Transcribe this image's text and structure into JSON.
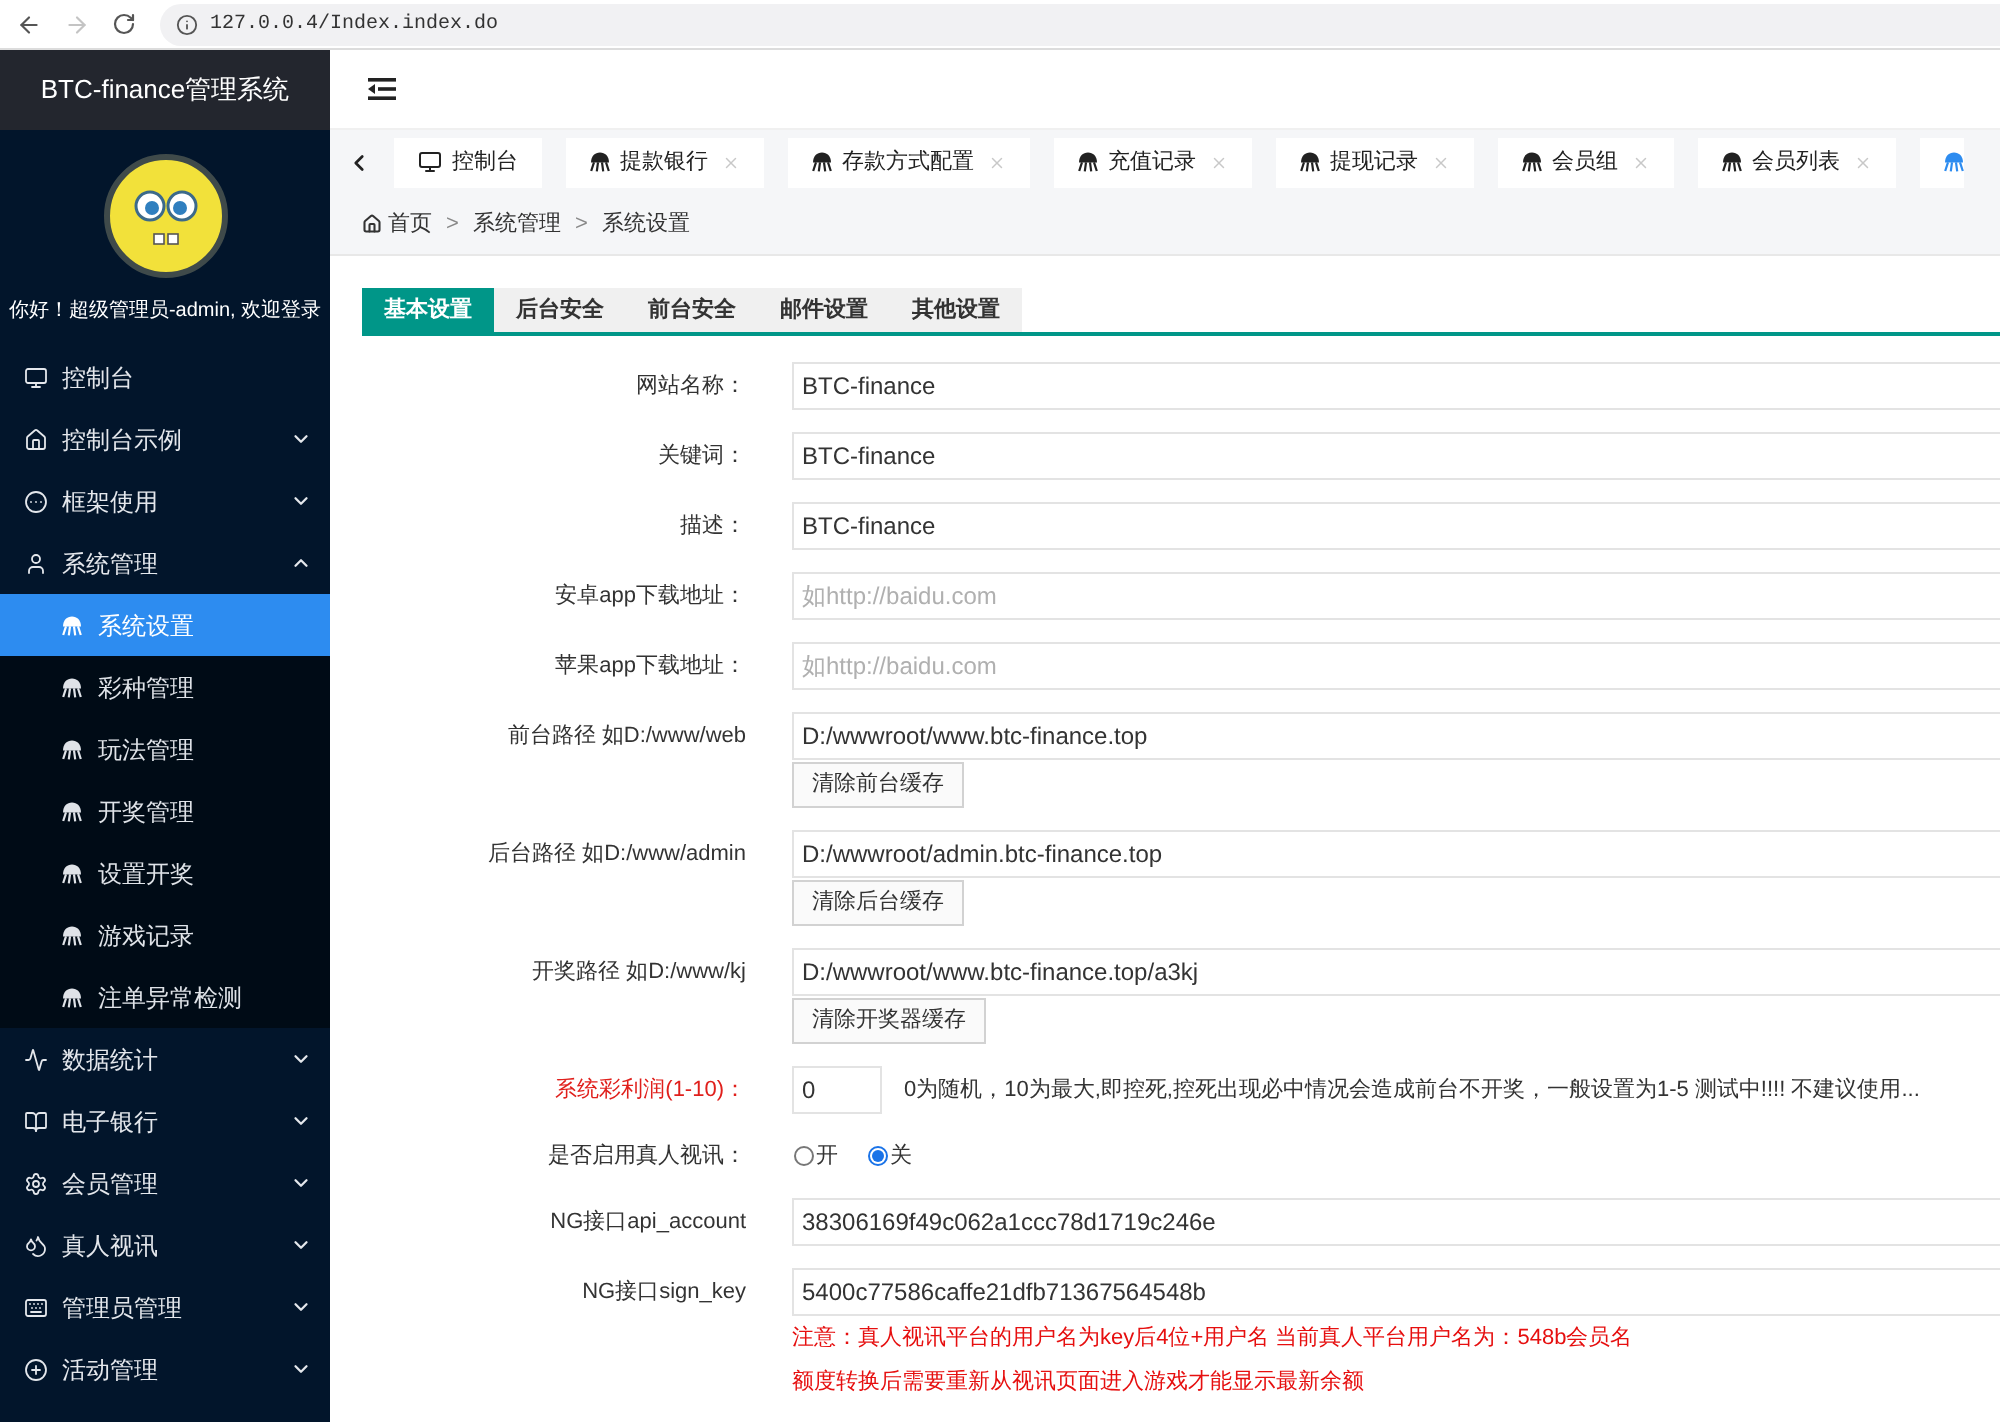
{
  "browser": {
    "back": {
      "disabled": false
    },
    "forward": {
      "disabled": true
    },
    "url": "127.0.0.4/Index.index.do"
  },
  "sidebar": {
    "title": "BTC-finance管理系统",
    "greeting": "你好！超级管理员-admin, 欢迎登录",
    "items": [
      {
        "kind": "link",
        "label": "控制台"
      },
      {
        "kind": "group",
        "label": "控制台示例",
        "expanded": false
      },
      {
        "kind": "group",
        "label": "框架使用",
        "expanded": false
      },
      {
        "kind": "group",
        "label": "系统管理",
        "expanded": true,
        "children": [
          {
            "label": "系统设置",
            "selected": true
          },
          {
            "label": "彩种管理",
            "selected": false
          },
          {
            "label": "玩法管理",
            "selected": false
          },
          {
            "label": "开奖管理",
            "selected": false
          },
          {
            "label": "设置开奖",
            "selected": false
          },
          {
            "label": "游戏记录",
            "selected": false
          },
          {
            "label": "注单异常检测",
            "selected": false
          }
        ]
      },
      {
        "kind": "group",
        "label": "数据统计",
        "expanded": false
      },
      {
        "kind": "group",
        "label": "电子银行",
        "expanded": false
      },
      {
        "kind": "group",
        "label": "会员管理",
        "expanded": false
      },
      {
        "kind": "group",
        "label": "真人视讯",
        "expanded": false
      },
      {
        "kind": "group",
        "label": "管理员管理",
        "expanded": false
      },
      {
        "kind": "group",
        "label": "活动管理",
        "expanded": false
      }
    ]
  },
  "page_tabs": [
    {
      "kind": "dashboard",
      "label": "控制台",
      "closable": false,
      "selected": false
    },
    {
      "kind": "page",
      "label": "提款银行",
      "closable": true,
      "selected": false
    },
    {
      "kind": "page",
      "label": "存款方式配置",
      "closable": true,
      "selected": false
    },
    {
      "kind": "page",
      "label": "充值记录",
      "closable": true,
      "selected": false
    },
    {
      "kind": "page",
      "label": "提现记录",
      "closable": true,
      "selected": false
    },
    {
      "kind": "page",
      "label": "会员组",
      "closable": true,
      "selected": false
    },
    {
      "kind": "page",
      "label": "会员列表",
      "closable": true,
      "selected": false
    },
    {
      "kind": "page",
      "closable": false,
      "selected": true
    }
  ],
  "breadcrumb": {
    "separator": ">",
    "items": [
      "首页",
      "系统管理",
      "系统设置"
    ]
  },
  "settings_tabs": [
    {
      "label": "基本设置",
      "selected": true
    },
    {
      "label": "后台安全",
      "selected": false
    },
    {
      "label": "前台安全",
      "selected": false
    },
    {
      "label": "邮件设置",
      "selected": false
    },
    {
      "label": "其他设置",
      "selected": false
    }
  ],
  "form": {
    "rows": [
      {
        "kind": "text",
        "label": "网站名称：",
        "value": "BTC-finance",
        "important": false
      },
      {
        "kind": "text",
        "label": "关键词：",
        "value": "BTC-finance",
        "important": false
      },
      {
        "kind": "text",
        "label": "描述：",
        "value": "BTC-finance",
        "important": false
      },
      {
        "kind": "text",
        "label": "安卓app下载地址：",
        "placeholder": "如http://baidu.com",
        "important": false
      },
      {
        "kind": "text",
        "label": "苹果app下载地址：",
        "placeholder": "如http://baidu.com",
        "important": false
      },
      {
        "kind": "path",
        "label": "前台路径 如D:/www/web",
        "value": "D:/wwwroot/www.btc-finance.top",
        "button": "清除前台缓存",
        "important": false
      },
      {
        "kind": "path",
        "label": "后台路径 如D:/www/admin",
        "value": "D:/wwwroot/admin.btc-finance.top",
        "button": "清除后台缓存",
        "important": false
      },
      {
        "kind": "path",
        "label": "开奖路径 如D:/www/kj",
        "value": "D:/wwwroot/www.btc-finance.top/a3kj",
        "button": "清除开奖器缓存",
        "important": false
      },
      {
        "kind": "number",
        "label": "系统彩利润(1-10)：",
        "value": "0",
        "hint": "0为随机，10为最大,即控死,控死出现必中情况会造成前台不开奖，一般设置为1-5 测试中!!!! 不建议使用...",
        "important": true
      },
      {
        "kind": "radio",
        "label": "是否启用真人视讯：",
        "options": [
          {
            "label": "开",
            "selected": false
          },
          {
            "label": "关",
            "selected": true
          }
        ],
        "important": false
      },
      {
        "kind": "text",
        "label": "NG接口api_account",
        "value": "38306169f49c062a1ccc78d1719c246e",
        "important": false
      },
      {
        "kind": "text",
        "label": "NG接口sign_key",
        "value": "5400c77586caffe21dfb71367564548b",
        "important": false,
        "notes": [
          "注意：真人视讯平台的用户名为key后4位+用户名 当前真人平台用户名为：548b会员名",
          "额度转换后需要重新从视讯页面进入游戏才能显示最新余额"
        ]
      }
    ]
  }
}
